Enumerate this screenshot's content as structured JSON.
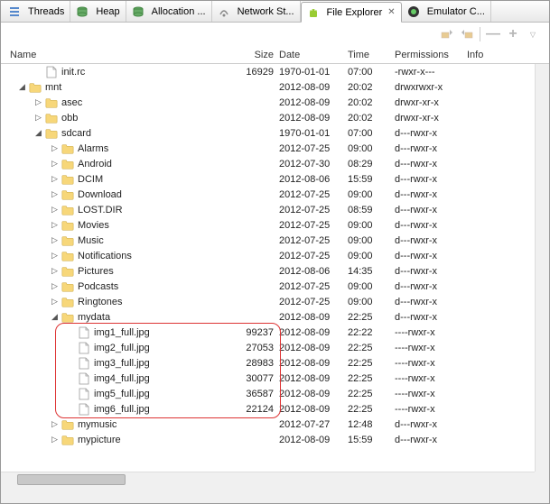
{
  "tabs": [
    {
      "label": "Threads",
      "icon": "threads"
    },
    {
      "label": "Heap",
      "icon": "heap"
    },
    {
      "label": "Allocation ...",
      "icon": "heap"
    },
    {
      "label": "Network St...",
      "icon": "net"
    },
    {
      "label": "File Explorer",
      "icon": "android",
      "active": true
    },
    {
      "label": "Emulator C...",
      "icon": "emu"
    }
  ],
  "columns": {
    "name": "Name",
    "size": "Size",
    "date": "Date",
    "time": "Time",
    "permissions": "Permissions",
    "info": "Info"
  },
  "rows": [
    {
      "indent": 1,
      "exp": "",
      "type": "file",
      "name": "init.rc",
      "size": "16929",
      "date": "1970-01-01",
      "time": "07:00",
      "perm": "-rwxr-x---"
    },
    {
      "indent": 0,
      "exp": "open",
      "type": "folder",
      "name": "mnt",
      "size": "",
      "date": "2012-08-09",
      "time": "20:02",
      "perm": "drwxrwxr-x"
    },
    {
      "indent": 1,
      "exp": "closed",
      "type": "folder",
      "name": "asec",
      "size": "",
      "date": "2012-08-09",
      "time": "20:02",
      "perm": "drwxr-xr-x"
    },
    {
      "indent": 1,
      "exp": "closed",
      "type": "folder",
      "name": "obb",
      "size": "",
      "date": "2012-08-09",
      "time": "20:02",
      "perm": "drwxr-xr-x"
    },
    {
      "indent": 1,
      "exp": "open",
      "type": "folder",
      "name": "sdcard",
      "size": "",
      "date": "1970-01-01",
      "time": "07:00",
      "perm": "d---rwxr-x"
    },
    {
      "indent": 2,
      "exp": "closed",
      "type": "folder",
      "name": "Alarms",
      "size": "",
      "date": "2012-07-25",
      "time": "09:00",
      "perm": "d---rwxr-x"
    },
    {
      "indent": 2,
      "exp": "closed",
      "type": "folder",
      "name": "Android",
      "size": "",
      "date": "2012-07-30",
      "time": "08:29",
      "perm": "d---rwxr-x"
    },
    {
      "indent": 2,
      "exp": "closed",
      "type": "folder",
      "name": "DCIM",
      "size": "",
      "date": "2012-08-06",
      "time": "15:59",
      "perm": "d---rwxr-x"
    },
    {
      "indent": 2,
      "exp": "closed",
      "type": "folder",
      "name": "Download",
      "size": "",
      "date": "2012-07-25",
      "time": "09:00",
      "perm": "d---rwxr-x"
    },
    {
      "indent": 2,
      "exp": "closed",
      "type": "folder",
      "name": "LOST.DIR",
      "size": "",
      "date": "2012-07-25",
      "time": "08:59",
      "perm": "d---rwxr-x"
    },
    {
      "indent": 2,
      "exp": "closed",
      "type": "folder",
      "name": "Movies",
      "size": "",
      "date": "2012-07-25",
      "time": "09:00",
      "perm": "d---rwxr-x"
    },
    {
      "indent": 2,
      "exp": "closed",
      "type": "folder",
      "name": "Music",
      "size": "",
      "date": "2012-07-25",
      "time": "09:00",
      "perm": "d---rwxr-x"
    },
    {
      "indent": 2,
      "exp": "closed",
      "type": "folder",
      "name": "Notifications",
      "size": "",
      "date": "2012-07-25",
      "time": "09:00",
      "perm": "d---rwxr-x"
    },
    {
      "indent": 2,
      "exp": "closed",
      "type": "folder",
      "name": "Pictures",
      "size": "",
      "date": "2012-08-06",
      "time": "14:35",
      "perm": "d---rwxr-x"
    },
    {
      "indent": 2,
      "exp": "closed",
      "type": "folder",
      "name": "Podcasts",
      "size": "",
      "date": "2012-07-25",
      "time": "09:00",
      "perm": "d---rwxr-x"
    },
    {
      "indent": 2,
      "exp": "closed",
      "type": "folder",
      "name": "Ringtones",
      "size": "",
      "date": "2012-07-25",
      "time": "09:00",
      "perm": "d---rwxr-x"
    },
    {
      "indent": 2,
      "exp": "open",
      "type": "folder",
      "name": "mydata",
      "size": "",
      "date": "2012-08-09",
      "time": "22:25",
      "perm": "d---rwxr-x"
    },
    {
      "indent": 3,
      "exp": "",
      "type": "file",
      "name": "img1_full.jpg",
      "size": "99237",
      "date": "2012-08-09",
      "time": "22:22",
      "perm": "----rwxr-x",
      "hl": true
    },
    {
      "indent": 3,
      "exp": "",
      "type": "file",
      "name": "img2_full.jpg",
      "size": "27053",
      "date": "2012-08-09",
      "time": "22:25",
      "perm": "----rwxr-x",
      "hl": true
    },
    {
      "indent": 3,
      "exp": "",
      "type": "file",
      "name": "img3_full.jpg",
      "size": "28983",
      "date": "2012-08-09",
      "time": "22:25",
      "perm": "----rwxr-x",
      "hl": true
    },
    {
      "indent": 3,
      "exp": "",
      "type": "file",
      "name": "img4_full.jpg",
      "size": "30077",
      "date": "2012-08-09",
      "time": "22:25",
      "perm": "----rwxr-x",
      "hl": true
    },
    {
      "indent": 3,
      "exp": "",
      "type": "file",
      "name": "img5_full.jpg",
      "size": "36587",
      "date": "2012-08-09",
      "time": "22:25",
      "perm": "----rwxr-x",
      "hl": true
    },
    {
      "indent": 3,
      "exp": "",
      "type": "file",
      "name": "img6_full.jpg",
      "size": "22124",
      "date": "2012-08-09",
      "time": "22:25",
      "perm": "----rwxr-x",
      "hl": true
    },
    {
      "indent": 2,
      "exp": "closed",
      "type": "folder",
      "name": "mymusic",
      "size": "",
      "date": "2012-07-27",
      "time": "12:48",
      "perm": "d---rwxr-x"
    },
    {
      "indent": 2,
      "exp": "closed",
      "type": "folder",
      "name": "mypicture",
      "size": "",
      "date": "2012-08-09",
      "time": "15:59",
      "perm": "d---rwxr-x"
    }
  ],
  "toolbar": {
    "minus": "—",
    "plus": "+"
  }
}
